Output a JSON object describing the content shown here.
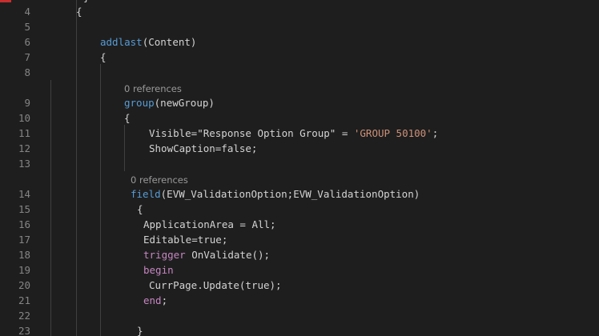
{
  "editor": {
    "colors": {
      "background": "#1e1e1e",
      "line_number": "#858585",
      "text": "#d4d4d4",
      "keyword": "#c586c0",
      "string": "#ce9178",
      "function": "#dcdcaa",
      "codelens": "#999999"
    },
    "top_partial": "}",
    "codelens": [
      {
        "text": "0 references",
        "after_line": "8"
      },
      {
        "text": "0 references",
        "after_line": "13"
      }
    ],
    "lines": [
      {
        "num": "4",
        "tokens": [
          {
            "t": "{",
            "c": "t-plain"
          }
        ]
      },
      {
        "num": "5",
        "tokens": []
      },
      {
        "num": "6",
        "tokens": [
          {
            "t": "addlast",
            "c": "t-link"
          },
          {
            "t": "(Content)",
            "c": "t-plain"
          }
        ]
      },
      {
        "num": "7",
        "tokens": [
          {
            "t": "{",
            "c": "t-plain"
          }
        ]
      },
      {
        "num": "8",
        "tokens": []
      },
      {
        "num": "9",
        "tokens": [
          {
            "t": "group",
            "c": "t-link"
          },
          {
            "t": "(newGroup)",
            "c": "t-plain"
          }
        ]
      },
      {
        "num": "10",
        "tokens": [
          {
            "t": "{",
            "c": "t-plain"
          }
        ]
      },
      {
        "num": "11",
        "tokens": [
          {
            "t": "Visible=\"Response Option Group\" = ",
            "c": "t-plain"
          },
          {
            "t": "'GROUP 50100'",
            "c": "t-str"
          },
          {
            "t": ";",
            "c": "t-plain"
          }
        ]
      },
      {
        "num": "12",
        "tokens": [
          {
            "t": "ShowCaption=false;",
            "c": "t-plain"
          }
        ]
      },
      {
        "num": "13",
        "tokens": []
      },
      {
        "num": "14",
        "tokens": [
          {
            "t": "field",
            "c": "t-link"
          },
          {
            "t": "(EVW_ValidationOption;EVW_ValidationOption)",
            "c": "t-plain"
          }
        ]
      },
      {
        "num": "15",
        "tokens": [
          {
            "t": "{",
            "c": "t-plain"
          }
        ]
      },
      {
        "num": "16",
        "tokens": [
          {
            "t": "ApplicationArea = All;",
            "c": "t-plain"
          }
        ]
      },
      {
        "num": "17",
        "tokens": [
          {
            "t": "Editable=true;",
            "c": "t-plain"
          }
        ]
      },
      {
        "num": "18",
        "tokens": [
          {
            "t": "trigger",
            "c": "t-kw"
          },
          {
            "t": " OnValidate",
            "c": "t-plain"
          },
          {
            "t": "();",
            "c": "t-plain"
          }
        ]
      },
      {
        "num": "19",
        "tokens": [
          {
            "t": "begin",
            "c": "t-kw"
          }
        ]
      },
      {
        "num": "20",
        "tokens": [
          {
            "t": "CurrPage",
            "c": "t-plain"
          },
          {
            "t": ".",
            "c": "t-plain"
          },
          {
            "t": "Update",
            "c": "t-plain"
          },
          {
            "t": "(true);",
            "c": "t-plain"
          }
        ]
      },
      {
        "num": "21",
        "tokens": [
          {
            "t": "end",
            "c": "t-kw"
          },
          {
            "t": ";",
            "c": "t-plain"
          }
        ]
      },
      {
        "num": "22",
        "tokens": []
      },
      {
        "num": "23",
        "tokens": [
          {
            "t": "}",
            "c": "t-plain"
          }
        ]
      }
    ]
  }
}
